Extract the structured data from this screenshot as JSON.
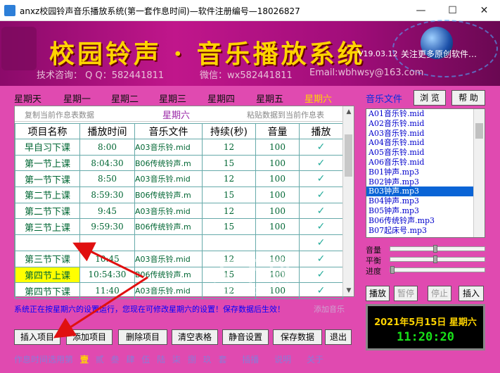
{
  "window": {
    "title": "anxz校园铃声音乐播放系统(第一套作息时间)—软件注册编号—18026827",
    "minimize": "—",
    "maximize": "☐",
    "close": "✕"
  },
  "banner": {
    "heading": "校园铃声 · 音乐播放系统",
    "version": "V19.03.12",
    "follow": "关注更多原创软件…",
    "contact_support": "技术咨询： Q Q：582441811",
    "contact_wechat": "微信：wx582441811",
    "contact_email": "Email:wbhwsy@163.com"
  },
  "days": [
    "星期天",
    "星期一",
    "星期二",
    "星期三",
    "星期四",
    "星期五",
    "星期六"
  ],
  "active_day_index": 6,
  "schedule": {
    "copy_label": "复制当前作息表数据",
    "paste_label": "粘贴数据到当前作息表",
    "day_title": "星期六",
    "columns": [
      "项目名称",
      "播放时间",
      "音乐文件",
      "持续(秒)",
      "音量",
      "播放"
    ],
    "rows": [
      {
        "name": "早自习下课",
        "time": "8:00",
        "file": "A03音乐铃.mid",
        "duration": "12",
        "volume": "100",
        "play": "✓"
      },
      {
        "name": "第一节上课",
        "time": "8:04:30",
        "file": "B06传统铃声.m",
        "duration": "15",
        "volume": "100",
        "play": "✓"
      },
      {
        "name": "第一节下课",
        "time": "8:50",
        "file": "A03音乐铃.mid",
        "duration": "12",
        "volume": "100",
        "play": "✓"
      },
      {
        "name": "第二节上课",
        "time": "8:59:30",
        "file": "B06传统铃声.m",
        "duration": "15",
        "volume": "100",
        "play": "✓"
      },
      {
        "name": "第二节下课",
        "time": "9:45",
        "file": "A03音乐铃.mid",
        "duration": "12",
        "volume": "100",
        "play": "✓"
      },
      {
        "name": "第三节上课",
        "time": "9:59:30",
        "file": "B06传统铃声.m",
        "duration": "15",
        "volume": "100",
        "play": "✓"
      },
      {
        "name": "",
        "time": "",
        "file": "",
        "duration": "",
        "volume": "",
        "play": "✓"
      },
      {
        "name": "第三节下课",
        "time": "10:45",
        "file": "A03音乐铃.mid",
        "duration": "12",
        "volume": "100",
        "play": "✓"
      },
      {
        "name": "第四节上课",
        "time": "10:54:30",
        "file": "B06传统铃声.m",
        "duration": "15",
        "volume": "100",
        "play": "✓"
      },
      {
        "name": "第四节下课",
        "time": "11:40",
        "file": "A03音乐铃.mid",
        "duration": "12",
        "volume": "100",
        "play": "✓"
      }
    ],
    "highlighted_row": 8
  },
  "status": {
    "message": "系统正在按星期六的设置运行，您现在可修改星期六的设置！保存数据后生效！",
    "extra": "添加音乐"
  },
  "buttons": {
    "insert": "插入项目",
    "add": "添加项目",
    "delete": "删除项目",
    "clear": "清空表格",
    "mute": "静音设置",
    "save": "保存数据",
    "exit": "退出"
  },
  "footer": {
    "label": "作息时间选用第",
    "options": [
      "壹",
      "贰",
      "叁",
      "肆",
      "伍",
      "陆",
      "柒",
      "捌",
      "玖"
    ],
    "suffix": "套",
    "extra1": "插播",
    "extra2": "说明",
    "extra3": "关于",
    "selected_index": 0
  },
  "music": {
    "label": "音乐文件",
    "browse": "浏 览",
    "help": "帮 助",
    "files": [
      "A01音乐铃.mid",
      "A02音乐铃.mid",
      "A03音乐铃.mid",
      "A04音乐铃.mid",
      "A05音乐铃.mid",
      "A06音乐铃.mid",
      "B01钟声.mp3",
      "B02钟声.mp3",
      "B03钟声.mp3",
      "B04钟声.mp3",
      "B05钟声.mp3",
      "B06传统铃声.mp3",
      "B07起床号.mp3"
    ],
    "selected_index": 8
  },
  "sliders": {
    "volume_label": "音量",
    "balance_label": "平衡",
    "progress_label": "进度",
    "volume": 0.48,
    "balance": 0.48,
    "progress": 0.0
  },
  "player": {
    "play": "播放",
    "pause": "暂停",
    "stop": "停止",
    "insert": "插入"
  },
  "clock": {
    "date": "2021年5月15日 星期六",
    "time": "11:20:20"
  },
  "watermark": {
    "text": "安下载",
    "url": "anxz.com"
  },
  "colors": {
    "background": "#e04ab0",
    "banner": "#c0168b",
    "active_day": "#ffd700",
    "highlight": "#ffff00",
    "selected_file": "#0a64d6",
    "arrow": "#e01010"
  }
}
